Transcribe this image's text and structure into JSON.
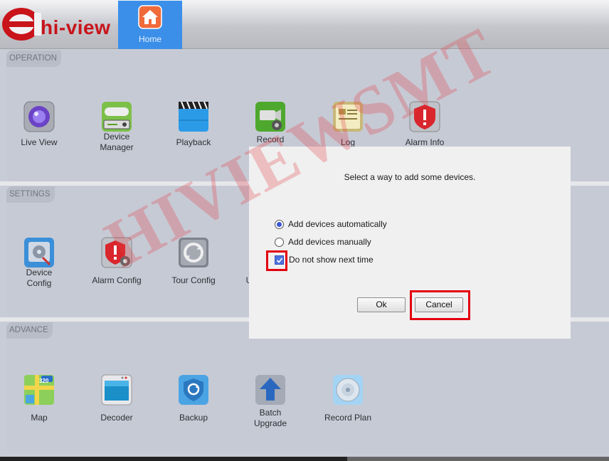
{
  "header": {
    "logo_text": "hi-view",
    "home_label": "Home"
  },
  "operation": {
    "label": "OPERATION",
    "items": [
      {
        "label": "Live View",
        "icon": "live-view-icon"
      },
      {
        "label": "Device\nManager",
        "icon": "device-manager-icon"
      },
      {
        "label": "Playback",
        "icon": "playback-icon"
      },
      {
        "label": "Record",
        "icon": "record-config-icon"
      },
      {
        "label": "Log",
        "icon": "log-icon"
      },
      {
        "label": "Alarm Info",
        "icon": "alarm-info-icon"
      }
    ]
  },
  "settings": {
    "label": "SETTINGS",
    "items": [
      {
        "label": "Device\nConfig",
        "icon": "device-config-icon"
      },
      {
        "label": "Alarm Config",
        "icon": "alarm-config-icon"
      },
      {
        "label": "Tour Config",
        "icon": "tour-config-icon"
      },
      {
        "label": "U",
        "icon": "user-icon"
      }
    ]
  },
  "advance": {
    "label": "ADVANCE",
    "items": [
      {
        "label": "Map",
        "icon": "map-icon"
      },
      {
        "label": "Decoder",
        "icon": "decoder-icon"
      },
      {
        "label": "Backup",
        "icon": "backup-icon"
      },
      {
        "label": "Batch\nUpgrade",
        "icon": "batch-upgrade-icon"
      },
      {
        "label": "Record Plan",
        "icon": "record-plan-icon"
      }
    ],
    "map_badge": "320"
  },
  "dialog": {
    "message": "Select a way to add some devices.",
    "option_auto": "Add devices automatically",
    "option_manual": "Add devices manually",
    "dont_show": "Do not show next time",
    "ok_label": "Ok",
    "cancel_label": "Cancel",
    "selected_option": "auto",
    "dont_show_checked": true
  },
  "watermark": "HIVIEWSMT",
  "colors": {
    "home_tab": "#3b8fe8",
    "logo_red": "#c8141a",
    "highlight_red": "#e3000f",
    "radio_fill": "#3a56d8"
  }
}
